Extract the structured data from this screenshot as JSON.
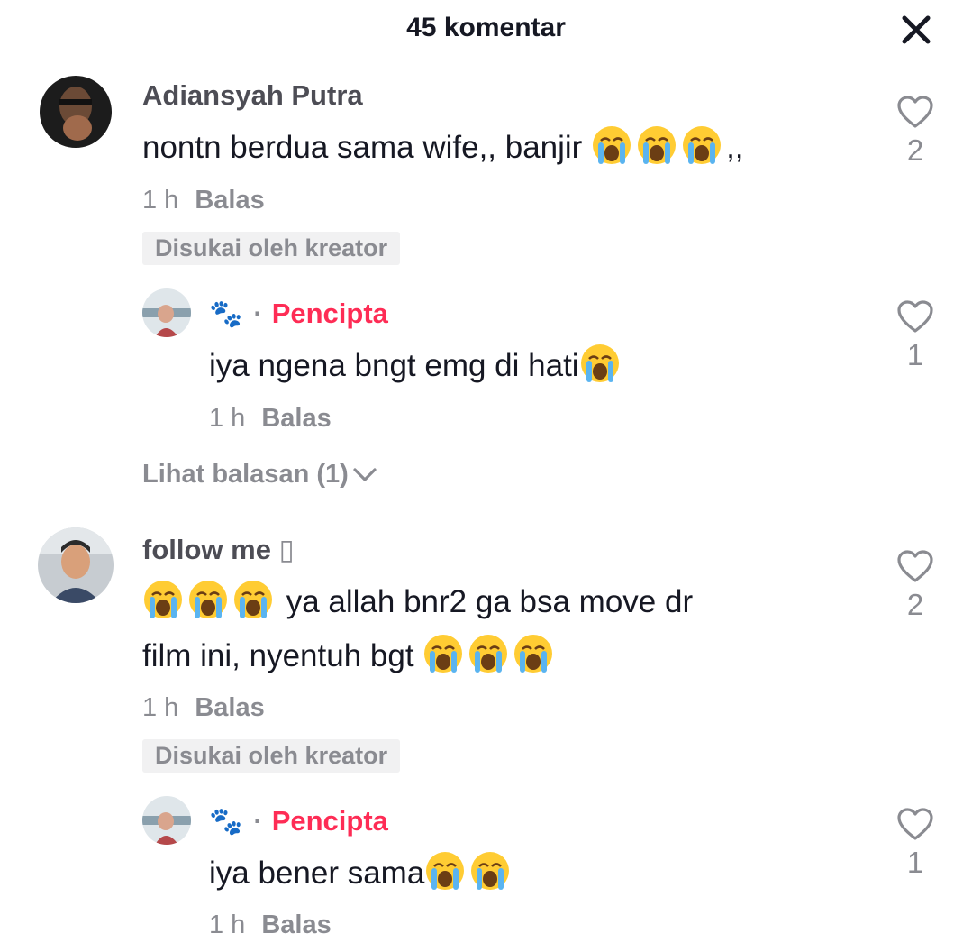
{
  "header": {
    "title": "45 komentar"
  },
  "comments": [
    {
      "username": "Adiansyah Putra",
      "text_before": "nontn berdua sama wife,, banjir ",
      "text_after": ",,",
      "time": "1 h",
      "reply_label": "Balas",
      "badge": "Disukai oleh kreator",
      "likes": "2",
      "reply": {
        "username_glyph": "🐾",
        "separator": "·",
        "creator_label": "Pencipta",
        "text": "iya ngena bngt emg di hati",
        "time": "1 h",
        "reply_label": "Balas",
        "likes": "1"
      },
      "view_replies": "Lihat balasan (1)"
    },
    {
      "username": "follow me",
      "username_suffix": "▯",
      "text_line1": " ya allah bnr2 ga bsa move dr",
      "text_line2": "film ini, nyentuh bgt ",
      "time": "1 h",
      "reply_label": "Balas",
      "badge": "Disukai oleh kreator",
      "likes": "2",
      "reply": {
        "username_glyph": "🐾",
        "separator": "·",
        "creator_label": "Pencipta",
        "text": "iya bener sama",
        "time": "1 h",
        "reply_label": "Balas",
        "likes": "1"
      }
    }
  ],
  "icons": {
    "close": "close-icon",
    "like": "heart-outline-icon",
    "emoji": "loudly-crying-face-emoji",
    "chevron": "chevron-down-icon"
  },
  "colors": {
    "creator": "#fe2c55",
    "secondary_text": "#8a8b91",
    "badge_bg": "#f1f1f2"
  }
}
